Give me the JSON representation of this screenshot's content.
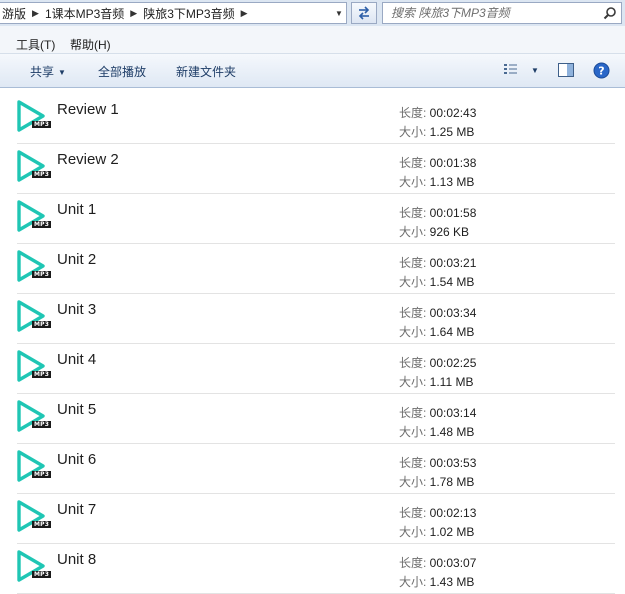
{
  "address": {
    "crumbs": [
      "游版",
      "1课本MP3音频",
      "陕旅3下MP3音频"
    ]
  },
  "search": {
    "placeholder": "搜索 陕旅3下MP3音频"
  },
  "menu": {
    "tools": "工具(T)",
    "help": "帮助(H)"
  },
  "toolbar": {
    "share": "共享",
    "play_all": "全部播放",
    "new_folder": "新建文件夹"
  },
  "labels": {
    "length": "长度: ",
    "size": "大小: "
  },
  "files": [
    {
      "name": "Review 1",
      "length": "00:02:43",
      "size": "1.25 MB"
    },
    {
      "name": "Review 2",
      "length": "00:01:38",
      "size": "1.13 MB"
    },
    {
      "name": "Unit 1",
      "length": "00:01:58",
      "size": "926 KB"
    },
    {
      "name": "Unit 2",
      "length": "00:03:21",
      "size": "1.54 MB"
    },
    {
      "name": "Unit 3",
      "length": "00:03:34",
      "size": "1.64 MB"
    },
    {
      "name": "Unit 4",
      "length": "00:02:25",
      "size": "1.11 MB"
    },
    {
      "name": "Unit 5",
      "length": "00:03:14",
      "size": "1.48 MB"
    },
    {
      "name": "Unit 6",
      "length": "00:03:53",
      "size": "1.78 MB"
    },
    {
      "name": "Unit 7",
      "length": "00:02:13",
      "size": "1.02 MB"
    },
    {
      "name": "Unit 8",
      "length": "00:03:07",
      "size": "1.43 MB"
    }
  ],
  "file_icon": {
    "name": "mp3-play-icon",
    "badge": "MP3",
    "color": "#1fc6b4"
  },
  "colors": {
    "help": "#2a67c8",
    "toolbar_text": "#1e3d67"
  }
}
